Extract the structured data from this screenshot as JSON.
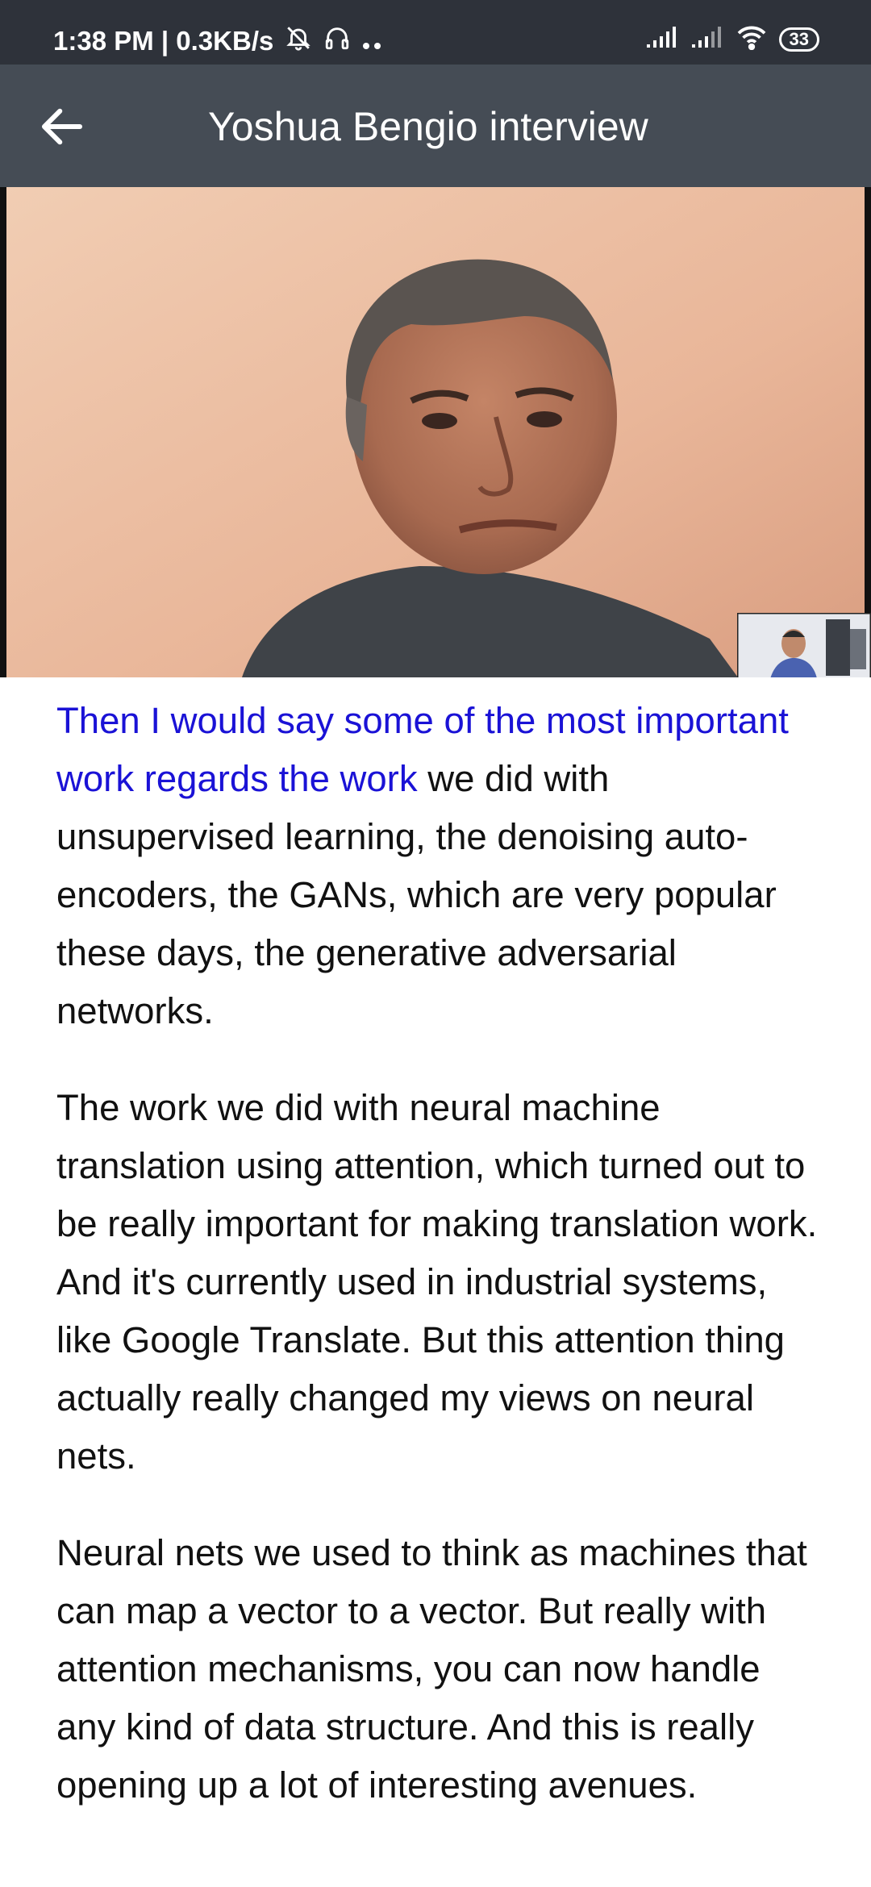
{
  "status_bar": {
    "time_speed": "1:38 PM | 0.3KB/s",
    "battery": "33",
    "icons": [
      "mute-icon",
      "headphones-icon",
      "more-dots-icon",
      "signal-icon",
      "signal-icon",
      "wifi-icon",
      "battery-icon"
    ]
  },
  "app_bar": {
    "title": "Yoshua Bengio interview",
    "back_icon": "arrow-left-icon"
  },
  "video": {
    "description_icon": "video-frame",
    "pip_icon": "pip-thumbnail"
  },
  "transcript": {
    "p1_highlight": "Then I would say some of the most important work regards the work",
    "p1_rest": " we did with unsupervised learning, the denoising auto-encoders, the GANs, which are very popular these days, the generative adversarial networks.",
    "p2": "The work we did with neural machine translation using attention, which turned out to be really important for making translation work. And it's currently used in industrial systems, like Google Translate. But this attention thing actually really changed my views on neural nets.",
    "p3": "Neural nets we used to think as machines that can map a vector to a vector. But really with attention mechanisms, you can now handle any kind of data structure. And this is really opening up a lot of interesting avenues."
  },
  "colors": {
    "status_bar": "#2e323a",
    "app_bar": "#454c55",
    "highlight": "#1a12d6"
  }
}
